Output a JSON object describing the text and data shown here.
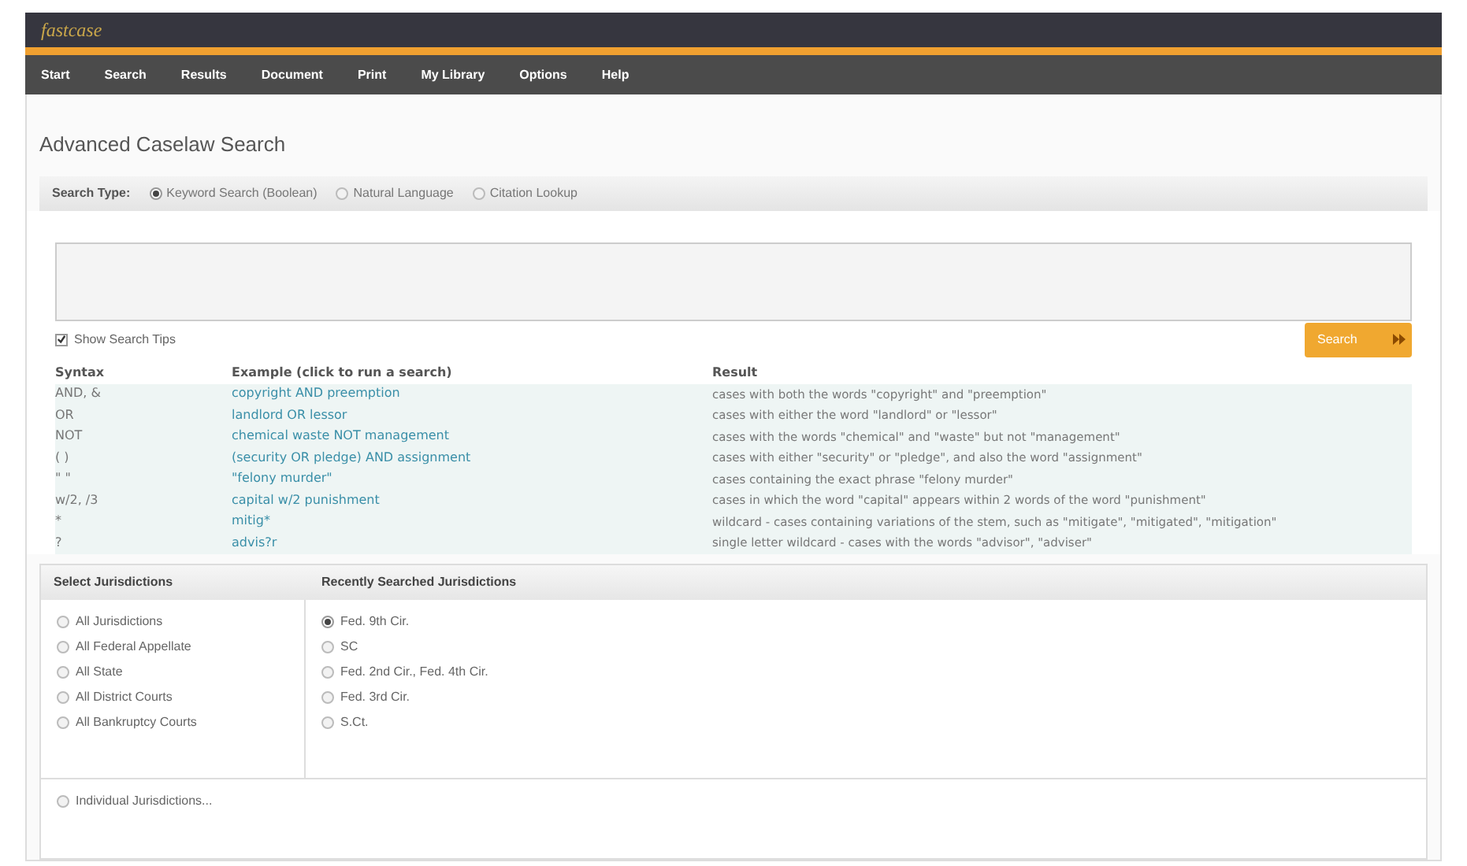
{
  "logo": "fastcase",
  "nav": [
    "Start",
    "Search",
    "Results",
    "Document",
    "Print",
    "My Library",
    "Options",
    "Help"
  ],
  "page_title": "Advanced Caselaw Search",
  "search_type": {
    "label": "Search Type:",
    "options": [
      {
        "label": "Keyword Search (Boolean)",
        "selected": true
      },
      {
        "label": "Natural Language",
        "selected": false
      },
      {
        "label": "Citation Lookup",
        "selected": false
      }
    ]
  },
  "show_search_tips": {
    "label": "Show Search Tips",
    "checked": true
  },
  "search_button": "Search",
  "tips": {
    "columns": [
      "Syntax",
      "Example (click to run a search)",
      "Result"
    ],
    "rows": [
      [
        "AND, &",
        "copyright AND preemption",
        "cases with both the words \"copyright\" and \"preemption\""
      ],
      [
        "OR",
        "landlord OR lessor",
        "cases with either the word \"landlord\" or \"lessor\""
      ],
      [
        "NOT",
        "chemical waste NOT management",
        "cases with the words \"chemical\" and \"waste\" but not \"management\""
      ],
      [
        "( )",
        "(security OR pledge) AND assignment",
        "cases with either \"security\" or \"pledge\", and also the word \"assignment\""
      ],
      [
        "\" \"",
        "\"felony murder\"",
        "cases containing the exact phrase \"felony murder\""
      ],
      [
        "w/2, /3",
        "capital w/2 punishment",
        "cases in which the word \"capital\" appears within 2 words of the word \"punishment\""
      ],
      [
        "*",
        "mitig*",
        "wildcard - cases containing variations of the stem, such as \"mitigate\", \"mitigated\", \"mitigation\""
      ],
      [
        "?",
        "advis?r",
        "single letter wildcard - cases with the words \"advisor\", \"adviser\""
      ]
    ]
  },
  "jurisdictions": {
    "title": "Select Jurisdictions",
    "options": [
      {
        "label": "All Jurisdictions",
        "selected": false
      },
      {
        "label": "All Federal Appellate",
        "selected": false
      },
      {
        "label": "All State",
        "selected": false
      },
      {
        "label": "All District Courts",
        "selected": false
      },
      {
        "label": "All Bankruptcy Courts",
        "selected": false
      }
    ]
  },
  "recent": {
    "title": "Recently Searched Jurisdictions",
    "options": [
      {
        "label": "Fed. 9th Cir.",
        "selected": true
      },
      {
        "label": "SC",
        "selected": false
      },
      {
        "label": "Fed. 2nd Cir., Fed. 4th Cir.",
        "selected": false
      },
      {
        "label": "Fed. 3rd Cir.",
        "selected": false
      },
      {
        "label": "S.Ct.",
        "selected": false
      }
    ]
  },
  "individual": {
    "label": "Individual Jurisdictions...",
    "selected": false
  }
}
